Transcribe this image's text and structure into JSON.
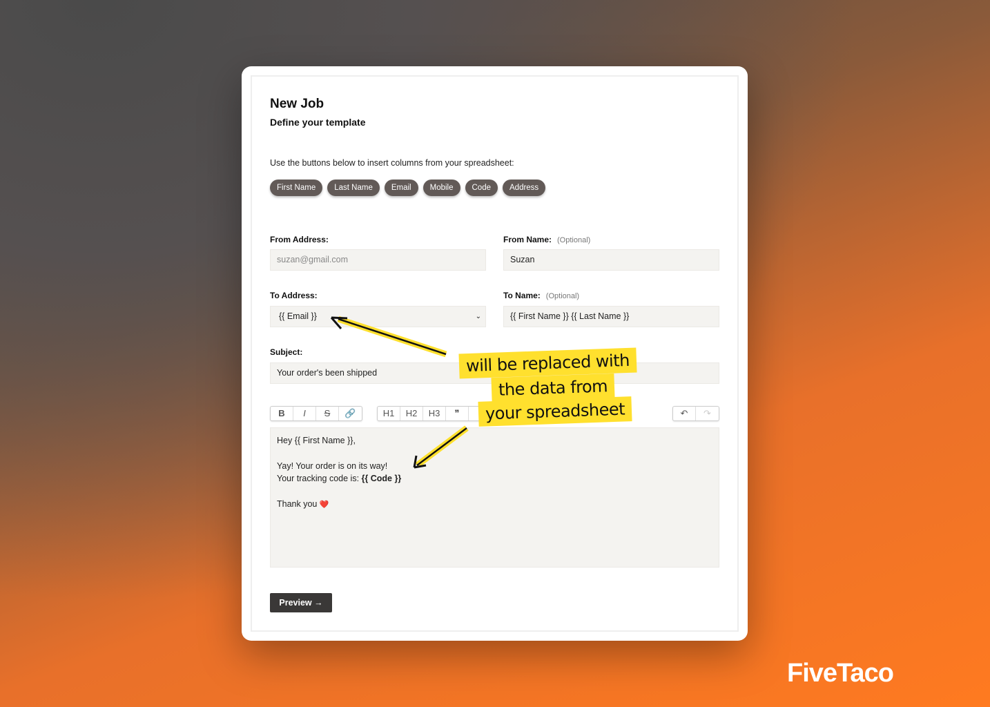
{
  "page": {
    "title": "New Job",
    "subtitle": "Define your template",
    "hint": "Use the buttons below to insert columns from your spreadsheet:"
  },
  "chips": [
    "First Name",
    "Last Name",
    "Email",
    "Mobile",
    "Code",
    "Address"
  ],
  "form": {
    "from_address": {
      "label": "From Address:",
      "placeholder": "suzan@gmail.com"
    },
    "from_name": {
      "label": "From Name:",
      "optional": "(Optional)",
      "value": "Suzan"
    },
    "to_address": {
      "label": "To Address:",
      "value": "{{ Email }}"
    },
    "to_name": {
      "label": "To Name:",
      "optional": "(Optional)",
      "value": "{{ First Name }} {{ Last Name }}"
    },
    "subject": {
      "label": "Subject:",
      "value": "Your order's been shipped"
    }
  },
  "toolbar": {
    "format": [
      "B",
      "I",
      "S",
      "🔗"
    ],
    "blocks": [
      "H1",
      "H2",
      "H3",
      "❞",
      "‹"
    ],
    "history": [
      "↶",
      "↷"
    ]
  },
  "body": {
    "line1": "Hey {{ First Name }},",
    "line2": "Yay! Your order is on its way!",
    "line3_prefix": "Your tracking code is: ",
    "line3_code": "{{ Code }}",
    "line4": "Thank you",
    "heart": "❤️"
  },
  "preview_button": "Preview →",
  "annotation": [
    "will be replaced with",
    "the data from",
    "your spreadsheet"
  ],
  "annotation_color": "#ffe02e",
  "brand": "FiveTaco"
}
